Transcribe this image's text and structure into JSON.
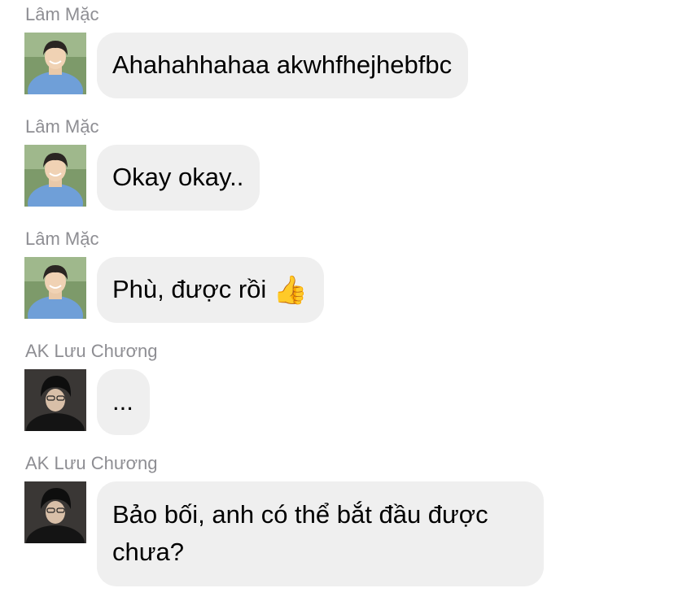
{
  "messages": [
    {
      "sender": "Lâm Mặc",
      "avatar_icon": "avatar-lam-mac-icon",
      "text": "Ahahahhahaa akwhfhejhebfbc",
      "emoji": ""
    },
    {
      "sender": "Lâm Mặc",
      "avatar_icon": "avatar-lam-mac-icon",
      "text": "Okay okay..",
      "emoji": ""
    },
    {
      "sender": "Lâm Mặc",
      "avatar_icon": "avatar-lam-mac-icon",
      "text": "Phù, được rồi",
      "emoji": "👍"
    },
    {
      "sender": "AK Lưu Chương",
      "avatar_icon": "avatar-ak-luu-chuong-icon",
      "text": "...",
      "emoji": ""
    },
    {
      "sender": "AK Lưu Chương",
      "avatar_icon": "avatar-ak-luu-chuong-icon",
      "text": "Bảo bối, anh có thể bắt đầu được",
      "text2": "chưa?",
      "emoji": ""
    }
  ],
  "colors": {
    "bubble_bg": "#efefef",
    "sender_text": "#8e8e93",
    "message_text": "#000000"
  }
}
